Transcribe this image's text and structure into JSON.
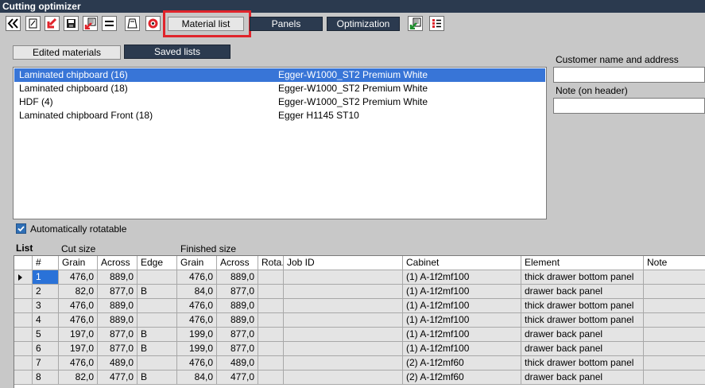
{
  "window": {
    "title": "Cutting optimizer"
  },
  "toolbar": {
    "icons": [
      "back-double-chevron-icon",
      "new-document-icon",
      "import-arrow-icon",
      "save-disk-icon",
      "export-sheet-icon",
      "equal-bars-icon",
      "cutting-board-icon",
      "lifebuoy-icon"
    ],
    "material_list_label": "Material list",
    "panels_label": "Panels",
    "optimization_label": "Optimization",
    "right_icons": [
      "export-green-arrow-icon",
      "list-checklist-icon"
    ]
  },
  "tabs": {
    "edited_materials": "Edited materials",
    "saved_lists": "Saved lists"
  },
  "materials": [
    {
      "name": "Laminated chipboard (16)",
      "decor": "Egger-W1000_ST2 Premium White",
      "selected": true
    },
    {
      "name": "Laminated chipboard (18)",
      "decor": "Egger-W1000_ST2 Premium White",
      "selected": false
    },
    {
      "name": "HDF (4)",
      "decor": "Egger-W1000_ST2 Premium White",
      "selected": false
    },
    {
      "name": "Laminated chipboard Front (18)",
      "decor": "Egger H1145 ST10",
      "selected": false
    }
  ],
  "customer": {
    "label": "Customer name and address",
    "value": ""
  },
  "note_header": {
    "label": "Note (on header)",
    "value": ""
  },
  "auto_rotatable": {
    "label": "Automatically rotatable",
    "checked": true
  },
  "list": {
    "title": "List",
    "group_cut": "Cut size",
    "group_finished": "Finished size",
    "columns": [
      "#",
      "Grain",
      "Across",
      "Edge",
      "Grain",
      "Across",
      "Rota.",
      "Job ID",
      "Cabinet",
      "Element",
      "Note"
    ],
    "rows": [
      [
        "1",
        "476,0",
        "889,0",
        "",
        "476,0",
        "889,0",
        "",
        "",
        "(1) A-1f2mf100",
        "thick drawer bottom panel",
        ""
      ],
      [
        "2",
        "82,0",
        "877,0",
        "B",
        "84,0",
        "877,0",
        "",
        "",
        "(1) A-1f2mf100",
        "drawer back panel",
        ""
      ],
      [
        "3",
        "476,0",
        "889,0",
        "",
        "476,0",
        "889,0",
        "",
        "",
        "(1) A-1f2mf100",
        "thick drawer bottom panel",
        ""
      ],
      [
        "4",
        "476,0",
        "889,0",
        "",
        "476,0",
        "889,0",
        "",
        "",
        "(1) A-1f2mf100",
        "thick drawer bottom panel",
        ""
      ],
      [
        "5",
        "197,0",
        "877,0",
        "B",
        "199,0",
        "877,0",
        "",
        "",
        "(1) A-1f2mf100",
        "drawer back panel",
        ""
      ],
      [
        "6",
        "197,0",
        "877,0",
        "B",
        "199,0",
        "877,0",
        "",
        "",
        "(1) A-1f2mf100",
        "drawer back panel",
        ""
      ],
      [
        "7",
        "476,0",
        "489,0",
        "",
        "476,0",
        "489,0",
        "",
        "",
        "(2) A-1f2mf60",
        "thick drawer bottom panel",
        ""
      ],
      [
        "8",
        "82,0",
        "477,0",
        "B",
        "84,0",
        "477,0",
        "",
        "",
        "(2) A-1f2mf60",
        "drawer back panel",
        ""
      ]
    ]
  },
  "colors": {
    "dark": "#2b3a4f",
    "selection": "#3875d7",
    "highlight": "#e0242b"
  }
}
